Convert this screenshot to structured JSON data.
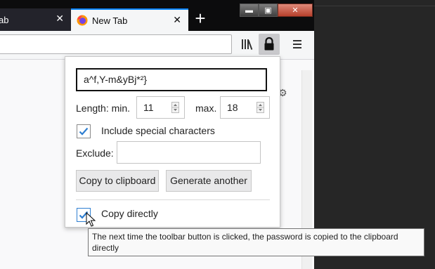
{
  "tabs": [
    {
      "label": "ab",
      "close": "✕"
    },
    {
      "label": "New Tab",
      "close": "✕"
    }
  ],
  "new_tab_label": "+",
  "window_controls": {
    "minimize": "▬",
    "maximize": "▣",
    "close": "✕"
  },
  "icons": {
    "firefox": "firefox-logo-icon",
    "library": "library-icon",
    "lock": "lock-icon",
    "menu": "hamburger-menu-icon"
  },
  "popup": {
    "password": "a^f,Y-m&yBj*²}",
    "length_label": "Length: min.",
    "min_value": "11",
    "max_label": "max.",
    "max_value": "18",
    "special_checked": true,
    "special_label": "Include special characters",
    "exclude_label": "Exclude:",
    "exclude_value": "",
    "copy_button": "Copy to clipboard",
    "generate_button": "Generate another",
    "direct_checked": true,
    "direct_label": "Copy directly"
  },
  "tooltip": "The next time the toolbar button is clicked, the password is copied to the clipboard directly",
  "colors": {
    "accent": "#0a84ff",
    "check": "#2f7fd1",
    "tabbar": "#0c0c0d"
  }
}
